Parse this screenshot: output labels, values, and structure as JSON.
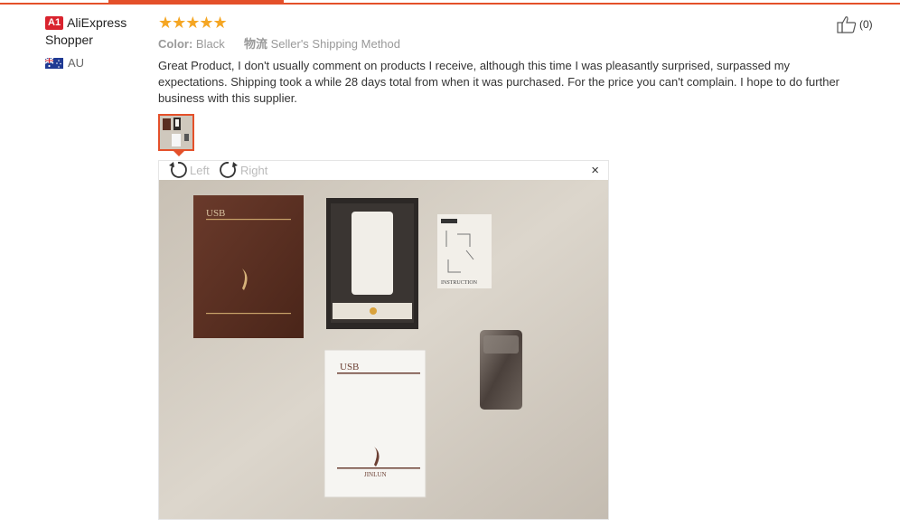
{
  "buyer": {
    "badge": "A1",
    "name": "AliExpress Shopper",
    "country": "AU",
    "flag_icon": "australia-flag-icon"
  },
  "review": {
    "rating": 5,
    "stars": "★★★★★",
    "color_label": "Color:",
    "color_value": "Black",
    "shipping_label": "物流",
    "shipping_value": "Seller's Shipping Method",
    "text": "Great Product, I don't usually comment on products I receive, although this time I was pleasantly surprised, surpassed my expectations. Shipping took a while 28 days total from when it was purchased. For the price you can't complain. I hope to do further business with this supplier.",
    "helpful_count": "(0)"
  },
  "viewer": {
    "rotate_left": "Left",
    "rotate_right": "Right",
    "close": "×"
  },
  "photo_labels": {
    "box_brown_usb": "USB",
    "box_white_usb": "USB",
    "box_white_brand": "JINLUN",
    "instruction": "INSTRUCTION"
  },
  "colors": {
    "accent": "#e4502a",
    "star": "#f5a623",
    "badge": "#d9232e"
  }
}
